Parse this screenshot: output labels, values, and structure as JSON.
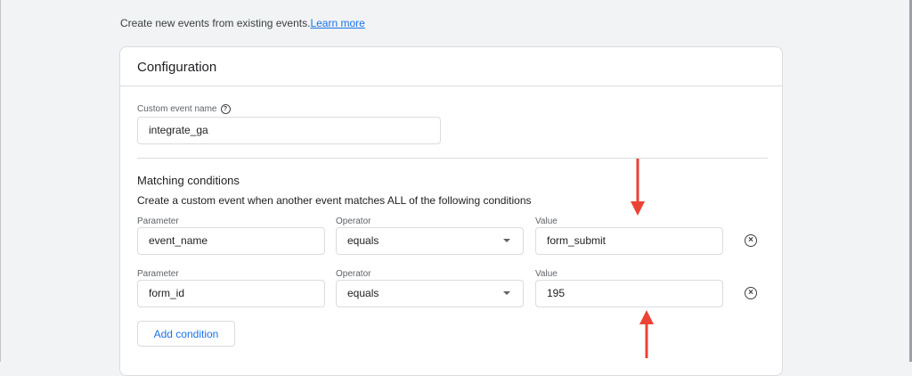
{
  "intro": {
    "text": "Create new events from existing events.",
    "link": "Learn more"
  },
  "configuration": {
    "title": "Configuration",
    "custom_event_name_label": "Custom event name",
    "custom_event_name_value": "integrate_ga"
  },
  "matching": {
    "title": "Matching conditions",
    "description": "Create a custom event when another event matches ALL of the following conditions",
    "conditions": [
      {
        "parameter_label": "Parameter",
        "parameter": "event_name",
        "operator_label": "Operator",
        "operator": "equals",
        "value_label": "Value",
        "value": "form_submit"
      },
      {
        "parameter_label": "Parameter",
        "parameter": "form_id",
        "operator_label": "Operator",
        "operator": "equals",
        "value_label": "Value",
        "value": "195"
      }
    ],
    "add_condition": "Add condition"
  },
  "colors": {
    "accent": "#1a73e8",
    "arrow": "#ea4335",
    "border": "#dadce0",
    "background": "#f1f3f4"
  },
  "icons": {
    "help": "help-circle-icon",
    "remove": "remove-circle-icon",
    "dropdown": "chevron-down-icon",
    "annotation": "red-arrow-icon"
  }
}
